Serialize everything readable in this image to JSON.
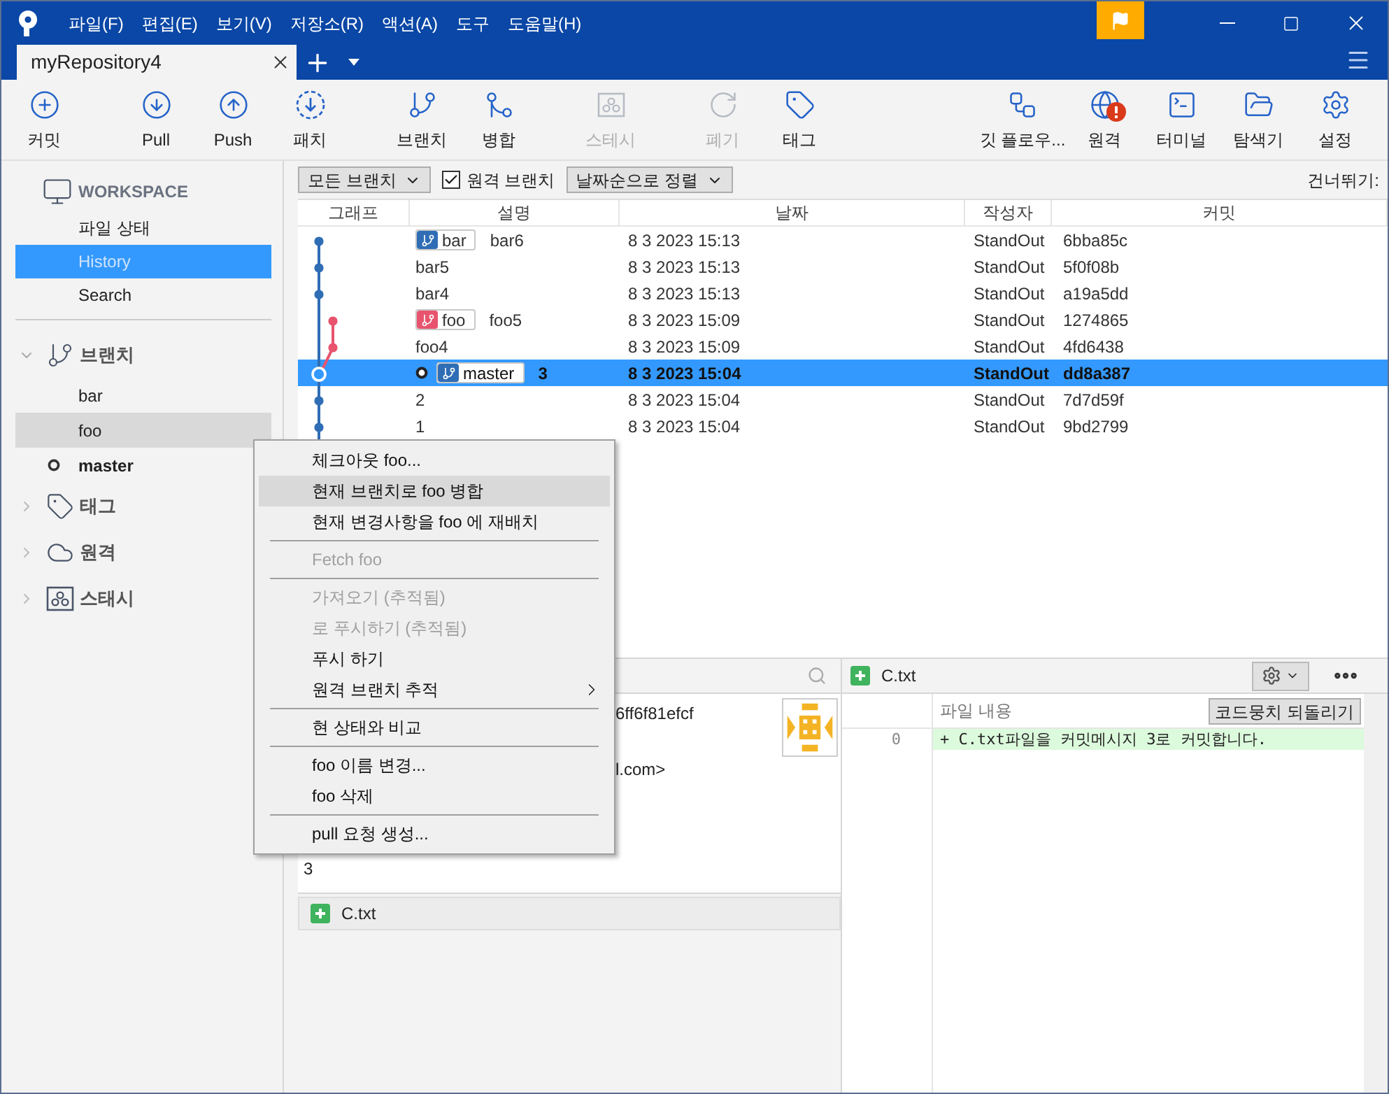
{
  "window": {
    "title": "myRepository4"
  },
  "menu_bar": [
    "파일(F)",
    "편집(E)",
    "보기(V)",
    "저장소(R)",
    "액션(A)",
    "도구",
    "도움말(H)"
  ],
  "toolbar": {
    "left": [
      [
        {
          "label": "커밋",
          "disabled": false
        }
      ],
      [
        {
          "label": "Pull",
          "disabled": false
        },
        {
          "label": "Push",
          "disabled": false
        },
        {
          "label": "패치",
          "disabled": false
        }
      ],
      [
        {
          "label": "브랜치",
          "disabled": false
        },
        {
          "label": "병합",
          "disabled": false
        }
      ],
      [
        {
          "label": "스테시",
          "disabled": true
        }
      ],
      [
        {
          "label": "폐기",
          "disabled": true
        },
        {
          "label": "태그",
          "disabled": false
        }
      ]
    ],
    "right": [
      {
        "label": "깃 플로우...",
        "alert": false
      },
      {
        "label": "원격",
        "alert": true
      },
      {
        "label": "터미널",
        "alert": false
      },
      {
        "label": "탐색기",
        "alert": false
      },
      {
        "label": "설정",
        "alert": false
      }
    ]
  },
  "sidebar": {
    "workspace": {
      "title": "WORKSPACE",
      "items": [
        {
          "label": "파일 상태",
          "selected": false
        },
        {
          "label": "History",
          "selected": true
        },
        {
          "label": "Search",
          "selected": false
        }
      ]
    },
    "sections": [
      {
        "title": "브랜치",
        "expanded": true,
        "items": [
          {
            "label": "bar",
            "current": false,
            "highlighted": false
          },
          {
            "label": "foo",
            "current": false,
            "highlighted": true
          },
          {
            "label": "master",
            "current": true,
            "highlighted": false
          }
        ]
      },
      {
        "title": "태그",
        "expanded": false
      },
      {
        "title": "원격",
        "expanded": false
      },
      {
        "title": "스태시",
        "expanded": false
      }
    ]
  },
  "filter_bar": {
    "branch_filter": "모든 브랜치",
    "remote_branches": {
      "label": "원격 브랜치",
      "checked": true
    },
    "sort": "날짜순으로 정렬",
    "jump": "건너뛰기:"
  },
  "table": {
    "columns": [
      "그래프",
      "설명",
      "날짜",
      "작성자",
      "커밋"
    ],
    "rows": [
      {
        "branch": {
          "name": "bar",
          "color": "#2f6db5"
        },
        "head": false,
        "description": "bar6",
        "date": "8 3 2023 15:13",
        "author": "StandOut",
        "commit": "6bba85c",
        "selected": false
      },
      {
        "head": false,
        "description": "bar5",
        "date": "8 3 2023 15:13",
        "author": "StandOut",
        "commit": "5f0f08b",
        "selected": false
      },
      {
        "head": false,
        "description": "bar4",
        "date": "8 3 2023 15:13",
        "author": "StandOut",
        "commit": "a19a5dd",
        "selected": false
      },
      {
        "branch": {
          "name": "foo",
          "color": "#e8546e"
        },
        "head": false,
        "description": "foo5",
        "date": "8 3 2023 15:09",
        "author": "StandOut",
        "commit": "1274865",
        "selected": false
      },
      {
        "head": false,
        "description": "foo4",
        "date": "8 3 2023 15:09",
        "author": "StandOut",
        "commit": "4fd6438",
        "selected": false
      },
      {
        "branch": {
          "name": "master",
          "color": "#2f6db5"
        },
        "head": true,
        "description": "3",
        "date": "8 3 2023 15:04",
        "author": "StandOut",
        "commit": "dd8a387",
        "selected": true
      },
      {
        "head": false,
        "description": "2",
        "date": "8 3 2023 15:04",
        "author": "StandOut",
        "commit": "7d7d59f",
        "selected": false
      },
      {
        "head": false,
        "description": "1",
        "date": "8 3 2023 15:04",
        "author": "StandOut",
        "commit": "9bd2799",
        "selected": false
      }
    ]
  },
  "details": {
    "hash": "6ff6f81efcf",
    "email": "l.com>",
    "message": "3",
    "files": [
      {
        "name": "C.txt"
      }
    ]
  },
  "diff": {
    "file": "C.txt",
    "column": "파일 내용",
    "revert_button": "코드뭉치 되돌리기",
    "lines": [
      {
        "number": "0",
        "text": "+ C.txt파일을 커밋메시지 3로 커밋합니다.",
        "kind": "added"
      }
    ]
  },
  "context_menu": [
    {
      "kind": "item",
      "label": "체크아웃 foo...",
      "disabled": false,
      "highlighted": false,
      "submenu": false
    },
    {
      "kind": "item",
      "label": "현재 브랜치로 foo 병합",
      "disabled": false,
      "highlighted": true,
      "submenu": false
    },
    {
      "kind": "item",
      "label": "현재 변경사항을 foo 에 재배치",
      "disabled": false,
      "highlighted": false,
      "submenu": false
    },
    {
      "kind": "separator"
    },
    {
      "kind": "item",
      "label": "Fetch foo",
      "disabled": true,
      "highlighted": false,
      "submenu": false
    },
    {
      "kind": "separator"
    },
    {
      "kind": "item",
      "label": "가져오기 (추적됨)",
      "disabled": true,
      "highlighted": false,
      "submenu": false
    },
    {
      "kind": "item",
      "label": "로 푸시하기 (추적됨)",
      "disabled": true,
      "highlighted": false,
      "submenu": false
    },
    {
      "kind": "item",
      "label": "푸시 하기",
      "disabled": false,
      "highlighted": false,
      "submenu": false
    },
    {
      "kind": "item",
      "label": "원격 브랜치 추적",
      "disabled": false,
      "highlighted": false,
      "submenu": true
    },
    {
      "kind": "separator"
    },
    {
      "kind": "item",
      "label": "현 상태와 비교",
      "disabled": false,
      "highlighted": false,
      "submenu": false
    },
    {
      "kind": "separator"
    },
    {
      "kind": "item",
      "label": "foo 이름 변경...",
      "disabled": false,
      "highlighted": false,
      "submenu": false
    },
    {
      "kind": "item",
      "label": "foo 삭제",
      "disabled": false,
      "highlighted": false,
      "submenu": false
    },
    {
      "kind": "separator"
    },
    {
      "kind": "item",
      "label": "pull 요청 생성...",
      "disabled": false,
      "highlighted": false,
      "submenu": false
    }
  ]
}
